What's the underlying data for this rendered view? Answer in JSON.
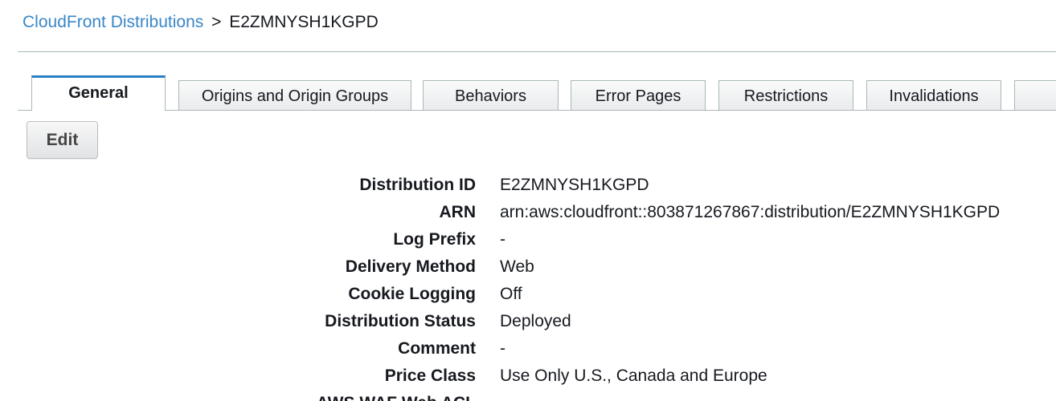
{
  "breadcrumb": {
    "parent": "CloudFront Distributions",
    "separator": ">",
    "current": "E2ZMNYSH1KGPD"
  },
  "tabs": [
    {
      "label": "General",
      "active": true
    },
    {
      "label": "Origins and Origin Groups",
      "active": false
    },
    {
      "label": "Behaviors",
      "active": false
    },
    {
      "label": "Error Pages",
      "active": false
    },
    {
      "label": "Restrictions",
      "active": false
    },
    {
      "label": "Invalidations",
      "active": false
    },
    {
      "label": "",
      "active": false
    }
  ],
  "toolbar": {
    "edit_label": "Edit"
  },
  "details": [
    {
      "label": "Distribution ID",
      "value": "E2ZMNYSH1KGPD"
    },
    {
      "label": "ARN",
      "value": "arn:aws:cloudfront::803871267867:distribution/E2ZMNYSH1KGPD"
    },
    {
      "label": "Log Prefix",
      "value": "-"
    },
    {
      "label": "Delivery Method",
      "value": "Web"
    },
    {
      "label": "Cookie Logging",
      "value": "Off"
    },
    {
      "label": "Distribution Status",
      "value": "Deployed"
    },
    {
      "label": "Comment",
      "value": "-"
    },
    {
      "label": "Price Class",
      "value": "Use Only U.S., Canada and Europe"
    },
    {
      "label": "AWS WAF Web ACL",
      "value": ""
    }
  ],
  "colors": {
    "link": "#3a87c8",
    "active_tab_accent": "#2a7fc5",
    "border": "#aab7b8"
  }
}
